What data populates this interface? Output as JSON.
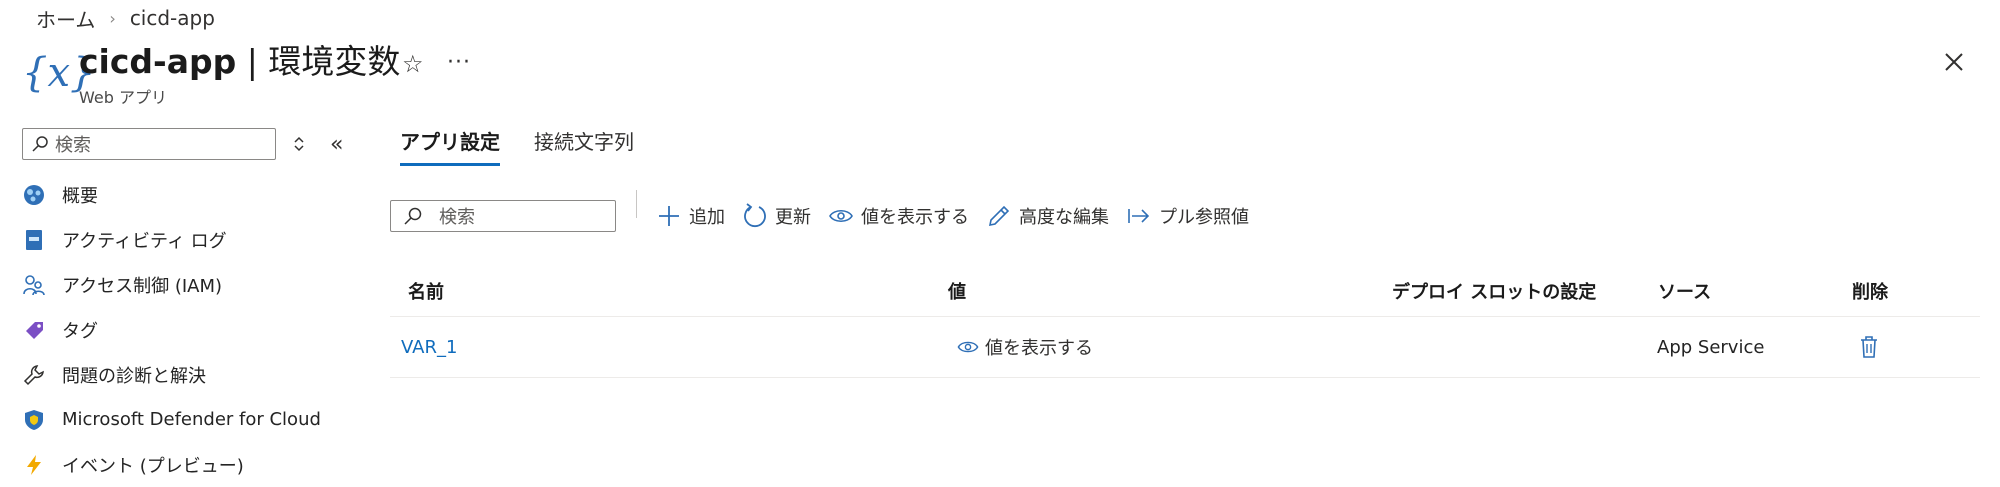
{
  "breadcrumb": {
    "home": "ホーム",
    "current": "cicd-app"
  },
  "header": {
    "app_name": "cicd-app",
    "separator": " | ",
    "page": "環境変数",
    "subtitle": "Web アプリ",
    "icon": "curly-x-icon"
  },
  "sidebar": {
    "search_placeholder": "検索",
    "items": [
      {
        "label": "概要",
        "icon": "overview-globe-icon"
      },
      {
        "label": "アクティビティ ログ",
        "icon": "activity-log-icon"
      },
      {
        "label": "アクセス制御 (IAM)",
        "icon": "iam-people-icon"
      },
      {
        "label": "タグ",
        "icon": "tag-icon"
      },
      {
        "label": "問題の診断と解決",
        "icon": "wrench-icon"
      },
      {
        "label": "Microsoft Defender for Cloud",
        "icon": "shield-icon"
      },
      {
        "label": "イベント (プレビュー)",
        "icon": "lightning-icon"
      }
    ]
  },
  "tabs": [
    {
      "label": "アプリ設定",
      "active": true
    },
    {
      "label": "接続文字列",
      "active": false
    }
  ],
  "toolbar": {
    "search_placeholder": "検索",
    "add": "追加",
    "refresh": "更新",
    "show_values": "値を表示する",
    "advanced_edit": "高度な編集",
    "pull_reference": "プル参照値"
  },
  "table": {
    "columns": {
      "name": "名前",
      "value": "値",
      "slot": "デプロイ スロットの設定",
      "source": "ソース",
      "delete": "削除"
    },
    "rows": [
      {
        "name": "VAR_1",
        "value_action": "値を表示する",
        "slot": "",
        "source": "App Service"
      }
    ]
  },
  "colors": {
    "accent": "#0f6cbd",
    "icon_blue": "#2f6fb6"
  }
}
